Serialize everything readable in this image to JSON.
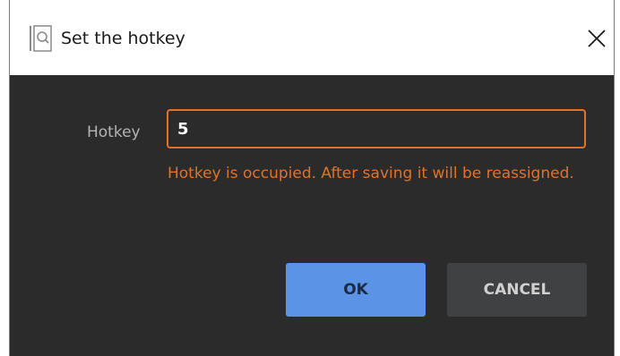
{
  "window": {
    "title": "Set the hotkey",
    "app_icon": "search-window-icon",
    "close_icon": "close-icon"
  },
  "form": {
    "hotkey_label": "Hotkey",
    "hotkey_value": "5",
    "error_message": "Hotkey is occupied. After saving it will be reassigned."
  },
  "buttons": {
    "ok_label": "OK",
    "cancel_label": "CANCEL"
  },
  "colors": {
    "background": "#2b2b2b",
    "accent_error": "#e0722a",
    "primary_button": "#5b93e6",
    "secondary_button": "#3f4143"
  }
}
